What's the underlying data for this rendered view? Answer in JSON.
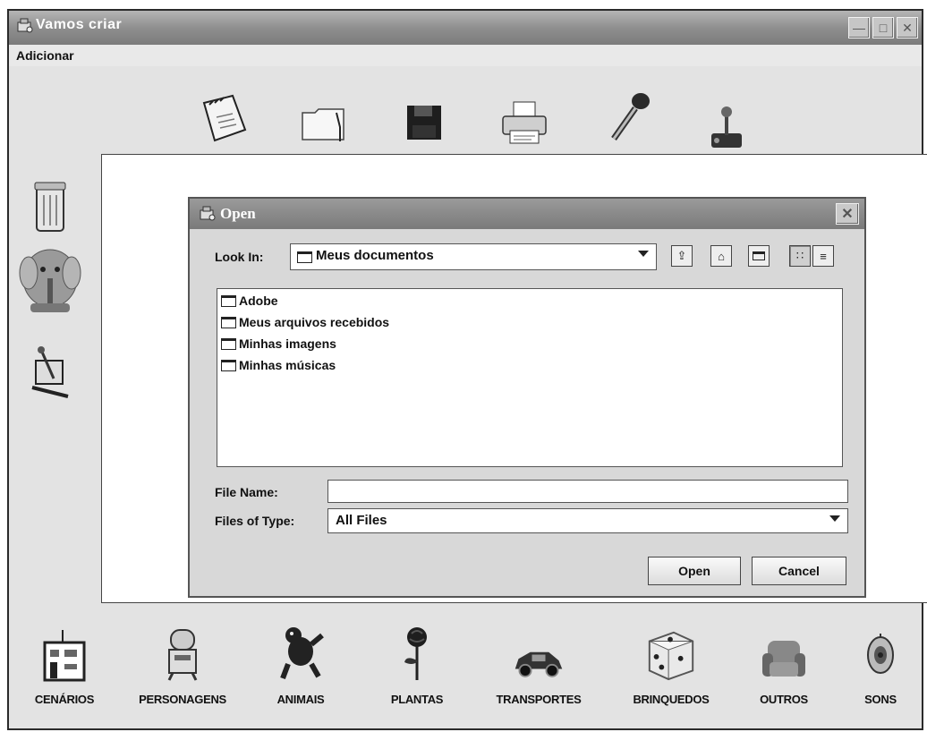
{
  "window": {
    "title": "Vamos criar",
    "controls": {
      "minimize_icon": "minimize-icon",
      "maximize_icon": "maximize-icon",
      "close_icon": "close-icon"
    }
  },
  "menubar": {
    "items": [
      "Adicionar"
    ]
  },
  "toolbar": {
    "icons": [
      "new-notebook-icon",
      "open-folder-icon",
      "save-disk-icon",
      "print-icon",
      "microphone-icon",
      "joystick-icon"
    ]
  },
  "left_palette": {
    "icons": [
      "trash-can-icon",
      "elephant-icon",
      "tools-icon"
    ]
  },
  "dialog": {
    "title": "Open",
    "look_in_label": "Look In:",
    "look_in_value": "Meus documentos",
    "toolbar_icons": [
      "up-one-level-icon",
      "home-icon",
      "new-folder-icon",
      "list-view-icon",
      "details-view-icon"
    ],
    "files": [
      "Adobe",
      "Meus arquivos recebidos",
      "Minhas imagens",
      "Minhas músicas"
    ],
    "file_name_label": "File Name:",
    "file_name_value": "",
    "files_of_type_label": "Files of Type:",
    "files_of_type_value": "All Files",
    "open_button": "Open",
    "cancel_button": "Cancel"
  },
  "categories": [
    {
      "label": "CENÁRIOS",
      "icon": "building-icon"
    },
    {
      "label": "PERSONAGENS",
      "icon": "robot-icon"
    },
    {
      "label": "ANIMAIS",
      "icon": "animal-icon"
    },
    {
      "label": "PLANTAS",
      "icon": "rose-icon"
    },
    {
      "label": "TRANSPORTES",
      "icon": "car-icon"
    },
    {
      "label": "BRINQUEDOS",
      "icon": "dice-icon"
    },
    {
      "label": "OUTROS",
      "icon": "armchair-icon"
    },
    {
      "label": "SONS",
      "icon": "speaker-icon"
    }
  ]
}
